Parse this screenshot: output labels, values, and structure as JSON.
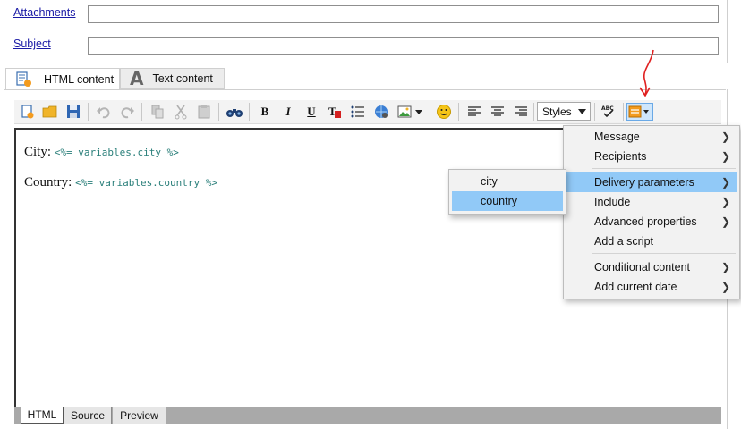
{
  "form": {
    "attachments_label": "Attachments",
    "subject_label": "Subject",
    "attachments_value": "",
    "subject_value": ""
  },
  "tabs": [
    {
      "label": "HTML content",
      "icon": "html-content-icon",
      "active": true
    },
    {
      "label": "Text content",
      "icon": "text-content-icon",
      "active": false
    }
  ],
  "toolbar": {
    "styles_label": "Styles",
    "items": [
      "new-document-icon",
      "open-folder-icon",
      "save-icon",
      "undo-icon",
      "redo-icon",
      "copy-icon",
      "cut-icon",
      "paste-icon",
      "find-binoculars-icon",
      "bold-icon",
      "italic-icon",
      "underline-icon",
      "text-color-icon",
      "bulleted-list-icon",
      "insert-link-icon",
      "insert-image-icon",
      "emoji-icon",
      "align-left-icon",
      "align-center-icon",
      "align-right-icon",
      "spell-check-icon",
      "personalization-fields-icon"
    ],
    "bold": "B",
    "italic": "I",
    "underline": "U",
    "spellcheck": "ABC"
  },
  "editor": {
    "lines": [
      {
        "label": "City:",
        "code": "<%= variables.city %>"
      },
      {
        "label": "Country:",
        "code": "<%= variables.country %>"
      }
    ]
  },
  "mode_tabs": [
    {
      "label": "HTML",
      "active": true
    },
    {
      "label": "Source",
      "active": false
    },
    {
      "label": "Preview",
      "active": false
    }
  ],
  "context_menu": {
    "items": [
      {
        "label": "Message",
        "submenu": true
      },
      {
        "label": "Recipients",
        "submenu": true
      },
      {
        "label": "Delivery parameters",
        "submenu": true,
        "highlighted": true
      },
      {
        "label": "Include",
        "submenu": true
      },
      {
        "label": "Advanced properties",
        "submenu": true
      },
      {
        "label": "Add a script",
        "submenu": false
      },
      {
        "label": "Conditional content",
        "submenu": true
      },
      {
        "label": "Add current date",
        "submenu": true
      }
    ]
  },
  "submenu": {
    "items": [
      {
        "label": "city",
        "highlighted": false
      },
      {
        "label": "country",
        "highlighted": true
      }
    ]
  },
  "colors": {
    "menu_highlight": "#91c9f7",
    "annotation_arrow": "#e02020",
    "code_text": "#2a7f7a",
    "link": "#1a1aa6"
  }
}
